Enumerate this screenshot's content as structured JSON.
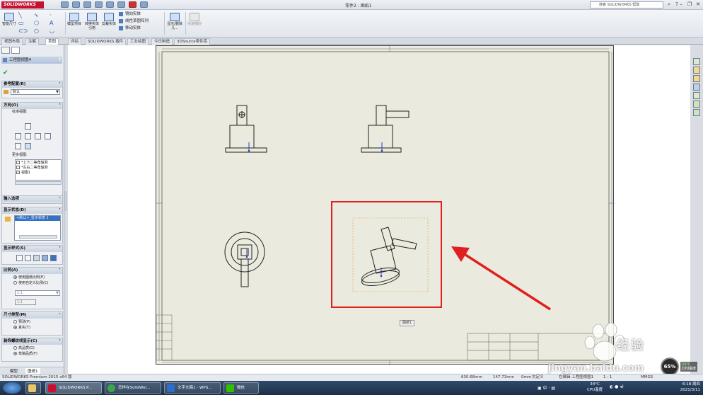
{
  "app": {
    "brand": "SOLIDWORKS",
    "title": "零件2 - 图纸1"
  },
  "search": {
    "placeholder": "搜索 SOLIDWORKS 帮助"
  },
  "ribbon": {
    "smart_dim": "智能尺寸",
    "model_items": "模型项目",
    "convert_entities": "转换实体引用",
    "trim": "剪裁实体",
    "mirror_entities": "镜向实体",
    "linear_pattern": "线性草图阵列",
    "move_entities": "移动实体",
    "show_hide": "显示/删除几...",
    "quick_snaps": "快速捕捉"
  },
  "tabs": [
    {
      "label": "视图布局",
      "active": false
    },
    {
      "label": "注解",
      "active": false
    },
    {
      "label": "草图",
      "active": true
    },
    {
      "label": "评估",
      "active": false
    },
    {
      "label": "SOLIDWORKS 插件",
      "active": false
    },
    {
      "label": "工业绘图",
      "active": false
    },
    {
      "label": "SOLIDWORKS 插件",
      "active": false
    },
    {
      "label": "今日制造",
      "active": false
    },
    {
      "label": "3DSource零件库",
      "active": false
    }
  ],
  "panel": {
    "title": "工程图视图4",
    "help": "?",
    "reference_config": {
      "header": "参考配置(R)",
      "value": "默认"
    },
    "orientation": {
      "header": "方向(O)",
      "standard_views": "标准视图:",
      "more_views": "更多视图:",
      "more_list": [
        "*上下二等角轴测",
        "*左右二等角轴测",
        "视图1"
      ]
    },
    "import_options": {
      "header": "输入选项"
    },
    "display_state": {
      "header": "显示状态(D)",
      "value": "<默认>_显示状态 1"
    },
    "display_style": {
      "header": "显示样式(S)"
    },
    "scale": {
      "header": "比例(A)",
      "options": [
        "使用图纸比例(E)",
        "使用自定义比例(C)"
      ],
      "selected": 0,
      "custom_value": "1:1",
      "custom_input": "1:1"
    },
    "dim_type": {
      "header": "尺寸类型(M)",
      "options": [
        "预测(P)",
        "真实(T)"
      ],
      "selected": 1
    },
    "thread_display": {
      "header": "装饰螺纹线显示(C)",
      "options": [
        "高品质(G)",
        "草稿品质(F)"
      ],
      "selected": 1
    },
    "bottom_tabs": [
      "模型",
      "图纸1"
    ]
  },
  "canvas": {
    "view_label": "图纸1"
  },
  "watermark": {
    "brand": "经验",
    "url": "jingyan.baidu.com"
  },
  "cpu": {
    "usage": "65%",
    "temp": "34°C",
    "temp_label": "CPU温度"
  },
  "status": {
    "product": "SOLIDWORKS Premium 2015 x64 版",
    "x": "630.68mm",
    "y": "147.73mm",
    "z": "0mm",
    "state": "欠定义",
    "editing": "在编辑 工程图视图1",
    "scale": "1 : 1",
    "units": "MMGS"
  },
  "taskbar": {
    "items": [
      "SOLIDWORKS P...",
      "怎样在SolidWor...",
      "文字文稿1 - WPS...",
      "微信"
    ],
    "weather_temp": "34°C",
    "weather_label": "CPU温度",
    "lang": "中",
    "time": "6:18 周四",
    "date": "2021/3/11"
  }
}
